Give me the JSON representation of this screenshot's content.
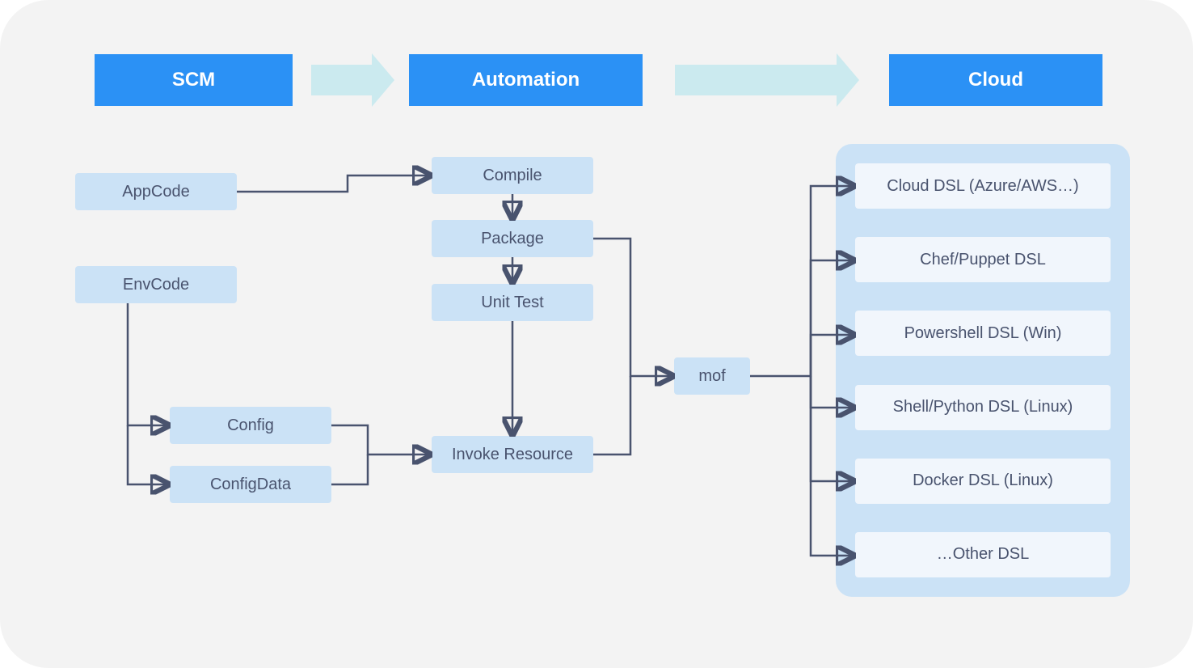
{
  "headers": {
    "scm": "SCM",
    "automation": "Automation",
    "cloud": "Cloud"
  },
  "nodes": {
    "appcode": "AppCode",
    "envcode": "EnvCode",
    "config": "Config",
    "configdata": "ConfigData",
    "compile": "Compile",
    "package": "Package",
    "unittest": "Unit Test",
    "invoke": "Invoke Resource",
    "mof": "mof"
  },
  "dsl": [
    "Cloud DSL (Azure/AWS…)",
    "Chef/Puppet DSL",
    "Powershell DSL (Win)",
    "Shell/Python DSL (Linux)",
    "Docker DSL (Linux)",
    "…Other DSL"
  ],
  "colors": {
    "header_bg": "#2b91f5",
    "flow_arrow": "#cbeaef",
    "node_bg": "#cbe2f6",
    "dsl_bg": "#f1f6fc",
    "text": "#49536e",
    "wire": "#49536e",
    "canvas": "#f3f3f3"
  }
}
